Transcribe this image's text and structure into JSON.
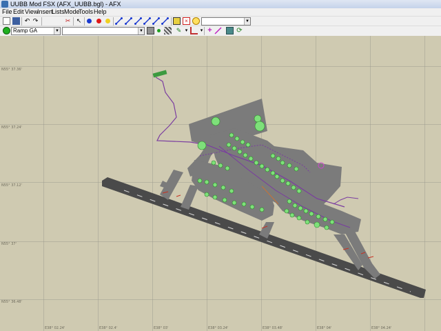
{
  "window": {
    "title": "UUBB Mod FSX (AFX_UUBB.bgl) - AFX",
    "accent": "#c5d3ea"
  },
  "menu": [
    "File",
    "Edit",
    "View",
    "Insert",
    "Lists",
    "Mode",
    "Tools",
    "Help"
  ],
  "toolbar": {
    "row1_icons": [
      "new-icon",
      "save-icon",
      "undo-icon",
      "redo-icon",
      "scissors-icon",
      "select-arrow-icon",
      "blue-point-icon",
      "red-point-icon",
      "yellow-point-icon",
      "link-icon",
      "link-icon",
      "link-icon",
      "link-icon",
      "link-icon",
      "link-icon",
      "link-icon",
      "taxi-sign-icon",
      "delete-icon",
      "clock-icon",
      "light-icon"
    ],
    "row1_combo_value": "",
    "mode_combo_value": "Ramp GA",
    "search_combo_value": "",
    "layer_combo_value": "",
    "row2_icons": [
      "gray-square-icon",
      "green-dot-icon",
      "hatch-icon",
      "paint-icon",
      "edge-icon",
      "plus-icon",
      "line-icon",
      "building-icon",
      "refresh-icon"
    ]
  },
  "map": {
    "lat_labels": [
      "N55° 37.36'",
      "N55° 37.24'",
      "N55° 37.12'",
      "N55° 37'",
      "N55° 36.48'"
    ],
    "lon_labels": [
      "E38° 02.24'",
      "E38° 02.4'",
      "E38° 03'",
      "E38° 03.24'",
      "E38° 03.48'",
      "E38° 04'",
      "E38° 04.24'"
    ],
    "colors": {
      "background": "#cfcab1",
      "apron": "#7b7b7b",
      "runway": "#4a4a4a",
      "taxi_path": "#7a3ca0",
      "parking": "#7ee07a",
      "parking_outline": "#2e8a2b"
    }
  }
}
